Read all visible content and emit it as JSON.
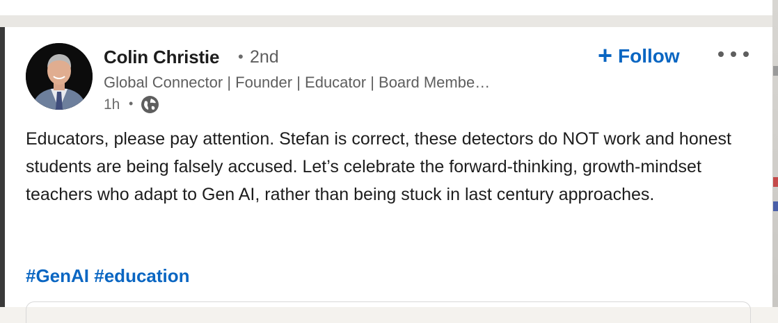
{
  "post": {
    "author": {
      "name": "Colin Christie",
      "separator": "•",
      "degree": "2nd",
      "headline": "Global Connector | Founder | Educator | Board Membe…",
      "time": "1h",
      "time_separator": "•",
      "visibility_icon": "globe-icon",
      "avatar_icon": "profile-photo"
    },
    "actions": {
      "follow_plus": "+",
      "follow_label": "Follow",
      "more_icon": "more-horizontal-icon"
    },
    "body": "Educators, please pay attention. Stefan is correct, these detectors do NOT work and honest students are being falsely accused. Let’s celebrate the forward-thinking, growth-mindset teachers who adapt to Gen AI, rather than being stuck in last century approaches.",
    "hashtags": [
      "#GenAI",
      "#education"
    ]
  },
  "colors": {
    "accent": "#0a66c2",
    "text": "#1d1d1d",
    "muted": "#5e5e5e",
    "background": "#f4f2ee"
  }
}
